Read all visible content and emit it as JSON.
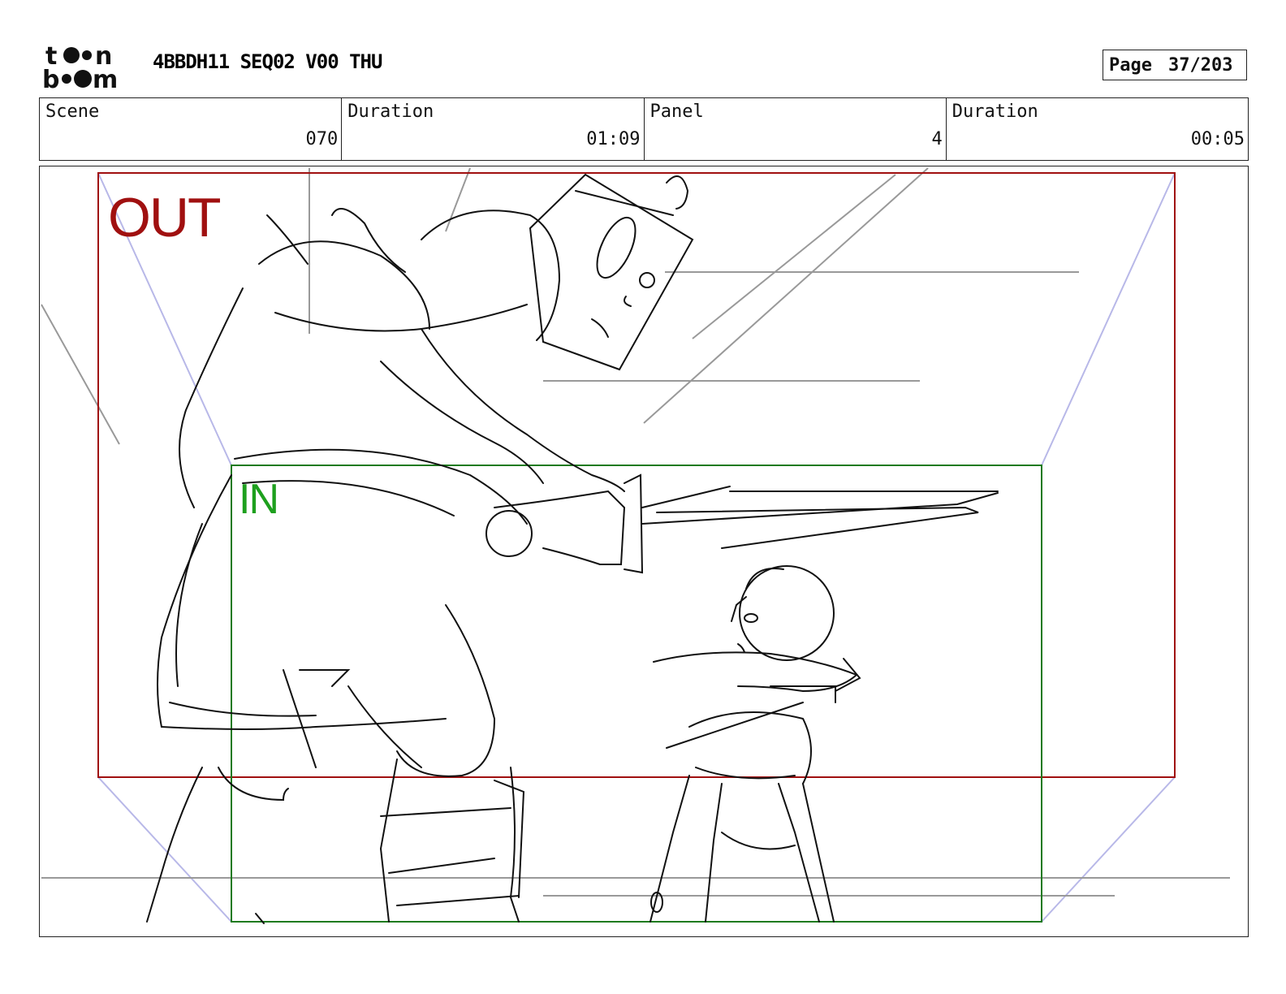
{
  "header": {
    "logo_text": "toon boom",
    "document_title": "4BBDH11 SEQ02 V00 THU",
    "page_label": "Page",
    "page_value": "37/203"
  },
  "info": {
    "scene_label": "Scene",
    "scene_value": "070",
    "scene_duration_label": "Duration",
    "scene_duration_value": "01:09",
    "panel_label": "Panel",
    "panel_value": "4",
    "panel_duration_label": "Duration",
    "panel_duration_value": "00:05"
  },
  "panel": {
    "out_label": "OUT",
    "in_label": "IN",
    "out_color": "#a01010",
    "in_color": "#1ea01e"
  }
}
